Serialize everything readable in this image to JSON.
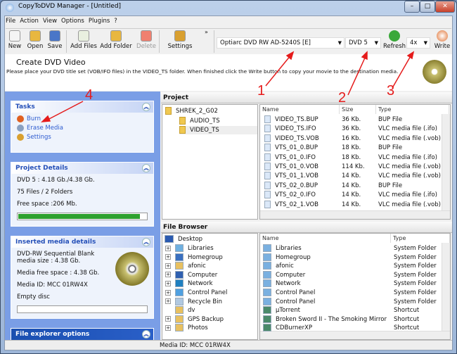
{
  "window": {
    "title": "CopyToDVD Manager - [Untitled]",
    "minimize": "–",
    "maximize": "□",
    "close": "✕"
  },
  "menu": [
    "File",
    "Action",
    "View",
    "Options",
    "Plugins",
    "?"
  ],
  "toolbar": {
    "buttons": [
      {
        "label": "New",
        "icon": "new-file-icon",
        "color": "#f4f4f4"
      },
      {
        "label": "Open",
        "icon": "open-folder-icon",
        "color": "#e8b740"
      },
      {
        "label": "Save",
        "icon": "save-disk-icon",
        "color": "#4a76c8"
      },
      {
        "label": "Add Files",
        "icon": "add-files-icon",
        "color": "#e9f0e0"
      },
      {
        "label": "Add Folder",
        "icon": "add-folder-icon",
        "color": "#e8b740"
      },
      {
        "label": "Delete",
        "icon": "delete-x-icon",
        "color": "#f08070",
        "disabled": true
      },
      {
        "label": "Settings",
        "icon": "gears-icon",
        "color": "#d9a030"
      }
    ],
    "overflow": "»",
    "drive": "Optiarc  DVD RW AD-5240S  [E]",
    "disc_type": "DVD 5",
    "refresh": "Refresh",
    "speed": "4x",
    "write": "Write"
  },
  "header": {
    "title": "Create DVD Video",
    "description": "Please place your DVD title set (VOB/IFO files) in the VIDEO_TS folder. When finished click the Write button to copy your movie to the destination media."
  },
  "tasks": {
    "title": "Tasks",
    "items": [
      {
        "label": "Burn",
        "color": "#e06020"
      },
      {
        "label": "Erase Media",
        "color": "#8aa0c0"
      },
      {
        "label": "Settings",
        "color": "#d9a030"
      }
    ]
  },
  "project_details": {
    "title": "Project Details",
    "lines": [
      "DVD 5 : 4.18 Gb./4.38 Gb.",
      "75 Files / 2 Folders",
      "Free space :206 Mb."
    ],
    "usage_percent": 95
  },
  "media_details": {
    "title": "Inserted media details",
    "lines": [
      "DVD-RW Sequential Blank media size : 4.38 Gb.",
      "Media free space : 4.38 Gb.",
      "Media ID: MCC 01RW4X",
      "Empty disc"
    ],
    "usage_percent": 0
  },
  "file_explorer_options": {
    "title": "File explorer options"
  },
  "project": {
    "title": "Project",
    "tree": [
      {
        "label": "SHREK_2_G02",
        "level": 0
      },
      {
        "label": "AUDIO_TS",
        "level": 1
      },
      {
        "label": "VIDEO_TS",
        "level": 1,
        "selected": true
      }
    ],
    "columns": [
      "Name",
      "Size",
      "Type"
    ],
    "files": [
      [
        "VIDEO_TS.BUP",
        "36 Kb.",
        "BUP File"
      ],
      [
        "VIDEO_TS.IFO",
        "36 Kb.",
        "VLC media file (.ifo)"
      ],
      [
        "VIDEO_TS.VOB",
        "16 Kb.",
        "VLC media file (.vob)"
      ],
      [
        "VTS_01_0.BUP",
        "18 Kb.",
        "BUP File"
      ],
      [
        "VTS_01_0.IFO",
        "18 Kb.",
        "VLC media file (.ifo)"
      ],
      [
        "VTS_01_0.VOB",
        "114 Kb.",
        "VLC media file (.vob)"
      ],
      [
        "VTS_01_1.VOB",
        "14 Kb.",
        "VLC media file (.vob)"
      ],
      [
        "VTS_02_0.BUP",
        "14 Kb.",
        "BUP File"
      ],
      [
        "VTS_02_0.IFO",
        "14 Kb.",
        "VLC media file (.ifo)"
      ],
      [
        "VTS_02_1.VOB",
        "14 Kb.",
        "VLC media file (.vob)"
      ]
    ]
  },
  "file_browser": {
    "title": "File Browser",
    "root": "Desktop",
    "tree": [
      {
        "label": "Libraries",
        "expand": true,
        "color": "#6fb0e0"
      },
      {
        "label": "Homegroup",
        "expand": true,
        "color": "#3a70c0"
      },
      {
        "label": "afonic",
        "expand": true,
        "color": "#e8c060"
      },
      {
        "label": "Computer",
        "expand": true,
        "color": "#3060b0"
      },
      {
        "label": "Network",
        "expand": true,
        "color": "#2080c0"
      },
      {
        "label": "Control Panel",
        "expand": true,
        "color": "#50a0e0"
      },
      {
        "label": "Recycle Bin",
        "expand": true,
        "color": "#b0c8e0"
      },
      {
        "label": "dv",
        "expand": false,
        "color": "#e8c060"
      },
      {
        "label": "GPS Backup",
        "expand": true,
        "color": "#e8c060"
      },
      {
        "label": "Photos",
        "expand": true,
        "color": "#e8c060"
      }
    ],
    "columns": [
      "Name",
      "Type"
    ],
    "items": [
      [
        "Libraries",
        "System Folder"
      ],
      [
        "Homegroup",
        "System Folder"
      ],
      [
        "afonic",
        "System Folder"
      ],
      [
        "Computer",
        "System Folder"
      ],
      [
        "Network",
        "System Folder"
      ],
      [
        "Control Panel",
        "System Folder"
      ],
      [
        "Control Panel",
        "System Folder"
      ],
      [
        "µTorrent",
        "Shortcut"
      ],
      [
        "Broken Sword II - The Smoking Mirror",
        "Shortcut"
      ],
      [
        "CDBurnerXP",
        "Shortcut"
      ]
    ]
  },
  "status": {
    "text": "Media ID: MCC 01RW4X"
  },
  "annotations": [
    "1",
    "2",
    "3",
    "4"
  ],
  "colors": {
    "annotation": "#e51b1b",
    "panel": "#7a9ee6",
    "progress": "#2ea12e"
  }
}
